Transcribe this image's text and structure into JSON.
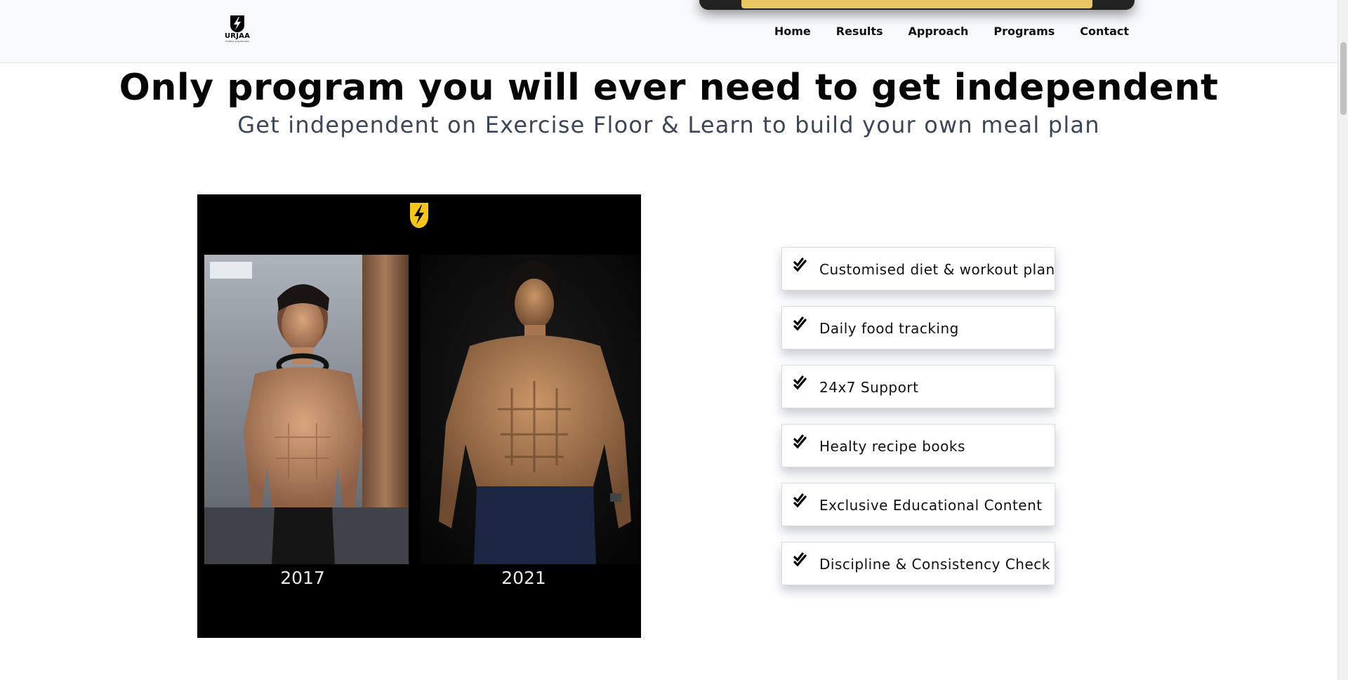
{
  "header": {
    "logo": {
      "name": "URJAA",
      "sub": "FITNESS & NUTRITION"
    },
    "nav": [
      {
        "label": "Home"
      },
      {
        "label": "Results"
      },
      {
        "label": "Approach"
      },
      {
        "label": "Programs"
      },
      {
        "label": "Contact"
      }
    ]
  },
  "hero": {
    "title": "Only program you will ever need to get independent",
    "subtitle": "Get independent on Exercise Floor & Learn to build your own meal plan"
  },
  "transformation": {
    "years": [
      "2017",
      "2021"
    ]
  },
  "features": [
    {
      "label": "Customised diet & workout plan",
      "icon": "check-double-icon"
    },
    {
      "label": "Daily food tracking",
      "icon": "check-double-icon"
    },
    {
      "label": "24x7 Support",
      "icon": "check-double-icon"
    },
    {
      "label": "Healty recipe books",
      "icon": "check-double-icon"
    },
    {
      "label": "Exclusive Educational Content",
      "icon": "check-double-icon"
    },
    {
      "label": "Discipline & Consistency Check",
      "icon": "check-double-icon"
    }
  ],
  "colors": {
    "brand_yellow": "#f5c518",
    "text_dark": "#050505",
    "subtitle": "#3b4658",
    "header_bg": "#f9fafb"
  }
}
